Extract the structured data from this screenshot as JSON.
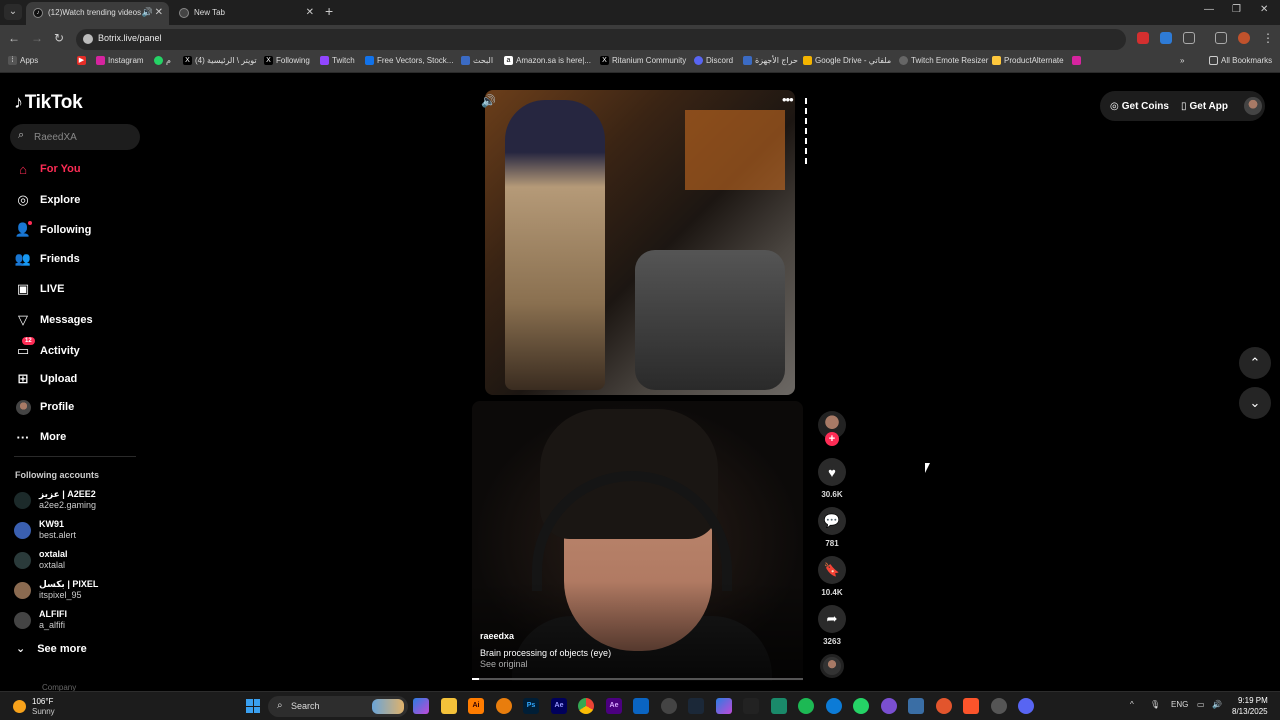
{
  "browser": {
    "tabs": [
      {
        "title": "(12)Watch trending videos",
        "active": true
      },
      {
        "title": "New Tab",
        "active": false
      }
    ],
    "url": "Botrix.live/panel",
    "bookmarks": [
      "Apps",
      "Instagram",
      "م",
      "تويتر \\ الرئيسية (4)",
      "Following",
      "Twitch",
      "Free Vectors, Stock...",
      "البحث",
      "Amazon.sa is here|...",
      "Ritanium Community",
      "Discord",
      "حراج الأجهزة",
      "Google Drive - ملفاتي",
      "Twitch Emote Resizer",
      "ProductAlternate"
    ],
    "all_bookmarks": "All Bookmarks"
  },
  "tiktok": {
    "logo": "TikTok",
    "search_placeholder": "RaeedXA",
    "nav": [
      {
        "label": "For You",
        "icon": "home-icon",
        "active": true
      },
      {
        "label": "Explore",
        "icon": "compass-icon"
      },
      {
        "label": "Following",
        "icon": "following-icon"
      },
      {
        "label": "Friends",
        "icon": "friends-icon"
      },
      {
        "label": "LIVE",
        "icon": "live-icon"
      },
      {
        "label": "Messages",
        "icon": "messages-icon"
      },
      {
        "label": "Activity",
        "icon": "activity-icon",
        "badge": "12"
      },
      {
        "label": "Upload",
        "icon": "upload-icon"
      },
      {
        "label": "Profile",
        "icon": "profile-avatar"
      },
      {
        "label": "More",
        "icon": "more-icon"
      }
    ],
    "following_accounts_title": "Following accounts",
    "following_accounts": [
      {
        "name": "عزيز | A2EE2",
        "handle": "a2ee2.gaming"
      },
      {
        "name": "KW91",
        "handle": "best.alert"
      },
      {
        "name": "oxtalal",
        "handle": "oxtalal"
      },
      {
        "name": "بكسل | PIXEL",
        "handle": "itspixel_95"
      },
      {
        "name": "ALFIFI",
        "handle": "a_alfifi"
      }
    ],
    "see_more": "See more",
    "company": "Company",
    "get_coins": "Get Coins",
    "get_app": "Get App",
    "video": {
      "author": "raeedxa",
      "caption": "Brain processing of objects (eye)",
      "see_original": "See original",
      "progress": 0.02,
      "likes": "30.6K",
      "comments": "781",
      "saves": "10.4K",
      "shares": "3263"
    }
  },
  "taskbar": {
    "temperature": "106°F",
    "condition": "Sunny",
    "search_label": "Search",
    "language": "ENG",
    "time": "9:19 PM",
    "date": "8/13/2025"
  }
}
